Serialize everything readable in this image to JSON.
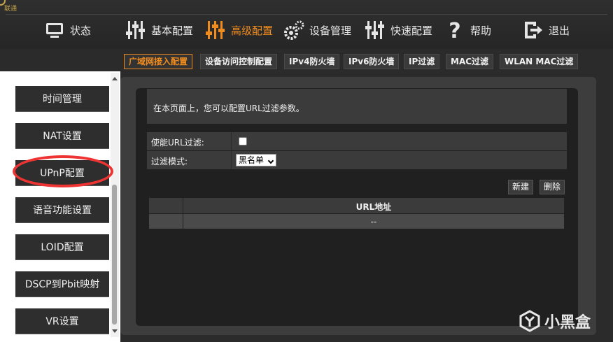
{
  "brand": {
    "text": "联通"
  },
  "nav": [
    {
      "label": "状态",
      "icon": "monitor-icon",
      "active": false
    },
    {
      "label": "基本配置",
      "icon": "sliders-icon",
      "active": false
    },
    {
      "label": "高级配置",
      "icon": "sliders-ad-icon",
      "active": true
    },
    {
      "label": "设备管理",
      "icon": "gears-icon",
      "active": false
    },
    {
      "label": "快速配置",
      "icon": "sliders-icon",
      "active": false
    },
    {
      "label": "帮助",
      "icon": "question-icon",
      "active": false
    },
    {
      "label": "退出",
      "icon": "logout-icon",
      "active": false
    }
  ],
  "subtabs": [
    {
      "label": "广域网接入配置",
      "active": true
    },
    {
      "label": "设备访问控制配置",
      "active": false
    },
    {
      "label": "IPv4防火墙",
      "active": false
    },
    {
      "label": "IPv6防火墙",
      "active": false
    },
    {
      "label": "IP过滤",
      "active": false
    },
    {
      "label": "MAC过滤",
      "active": false
    },
    {
      "label": "WLAN MAC过滤",
      "active": false
    }
  ],
  "sidebar": {
    "items": [
      {
        "label": "时间管理"
      },
      {
        "label": "NAT设置"
      },
      {
        "label": "UPnP配置"
      },
      {
        "label": "语音功能设置"
      },
      {
        "label": "LOID配置"
      },
      {
        "label": "DSCP到Pbit映射"
      },
      {
        "label": "VR设置"
      }
    ]
  },
  "main": {
    "description": "在本页面上，您可以配置URL过滤参数。",
    "enable_label": "使能URL过滤:",
    "enable_checked": false,
    "mode_label": "过滤模式:",
    "mode_value": "黑名单",
    "new_button": "新建",
    "delete_button": "删除",
    "table": {
      "headers": [
        "",
        "URL地址"
      ],
      "rows": [
        [
          "",
          "--"
        ]
      ]
    }
  },
  "watermark": {
    "text": "小黑盒"
  },
  "colors": {
    "accent": "#f08c1e",
    "highlight": "#e33333"
  }
}
